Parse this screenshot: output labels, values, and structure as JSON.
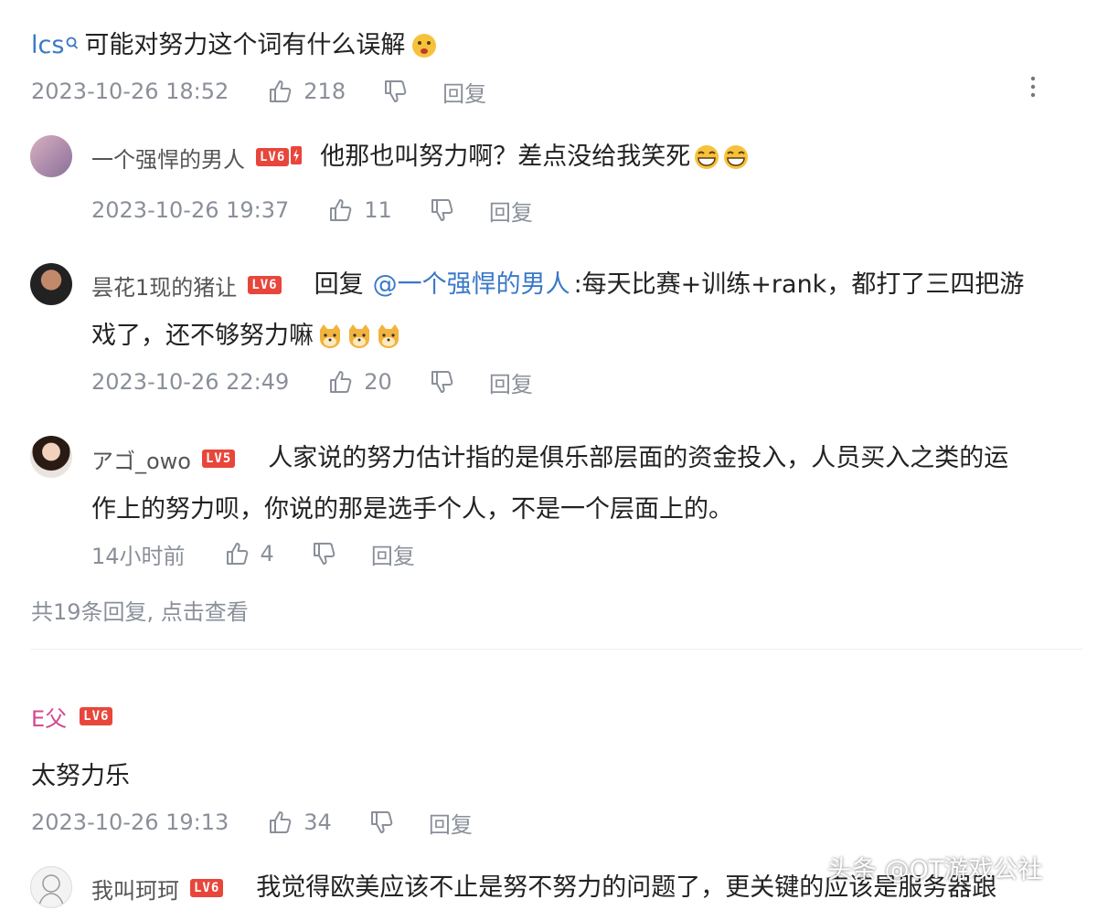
{
  "root_comment": {
    "username": "lcs",
    "text": "可能对努力这个词有什么误解",
    "time": "2023-10-26 18:52",
    "likes": "218",
    "reply_label": "回复"
  },
  "replies": [
    {
      "username": "一个强悍的男人",
      "level": "LV6",
      "text": "他那也叫努力啊？差点没给我笑死",
      "time": "2023-10-26 19:37",
      "likes": "11",
      "reply_label": "回复"
    },
    {
      "username": "昙花1现的猪让",
      "level": "LV6",
      "reply_prefix": "回复",
      "mention": "@一个强悍的男人",
      "text_line1": ":每天比赛+训练+rank，都打了三四把游",
      "text_line2": "戏了，还不够努力嘛",
      "time": "2023-10-26 22:49",
      "likes": "20",
      "reply_label": "回复"
    },
    {
      "username": "アゴ_owo",
      "level": "LV5",
      "text_line1": "人家说的努力估计指的是俱乐部层面的资金投入，人员买入之类的运",
      "text_line2": "作上的努力呗，你说的那是选手个人，不是一个层面上的。",
      "time": "14小时前",
      "likes": "4",
      "reply_label": "回复"
    }
  ],
  "more_replies": "共19条回复, 点击查看",
  "second_comment": {
    "username": "E父",
    "level": "LV6",
    "text": "太努力乐",
    "time": "2023-10-26 19:13",
    "likes": "34",
    "reply_label": "回复"
  },
  "third_comment": {
    "username": "我叫珂珂",
    "level": "LV6",
    "text": "我觉得欧美应该不止是努不努力的问题了，更关键的应该是服务器跟"
  },
  "watermark": "头条 @OT游戏公社",
  "colors": {
    "badge": "#e8463b",
    "mention": "#3a78c9",
    "meta": "#8a8f99"
  }
}
